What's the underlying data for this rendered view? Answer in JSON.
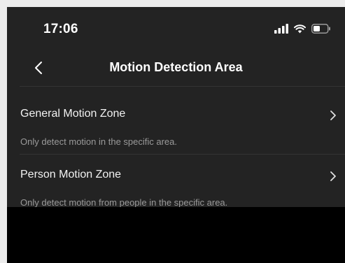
{
  "status_bar": {
    "time": "17:06",
    "icons": [
      "signal-icon",
      "wifi-icon",
      "battery-icon"
    ]
  },
  "nav": {
    "back_icon": "chevron-left-icon",
    "title": "Motion Detection Area"
  },
  "items": [
    {
      "label": "General Motion Zone",
      "description": "Only detect motion in the specific area.",
      "icon": "chevron-right-icon"
    },
    {
      "label": "Person Motion Zone",
      "description": "Only detect motion from people in the specific area.",
      "icon": "chevron-right-icon"
    }
  ],
  "colors": {
    "background": "#232323",
    "text_primary": "#f2f2f2",
    "text_secondary": "#9a9a9a"
  }
}
